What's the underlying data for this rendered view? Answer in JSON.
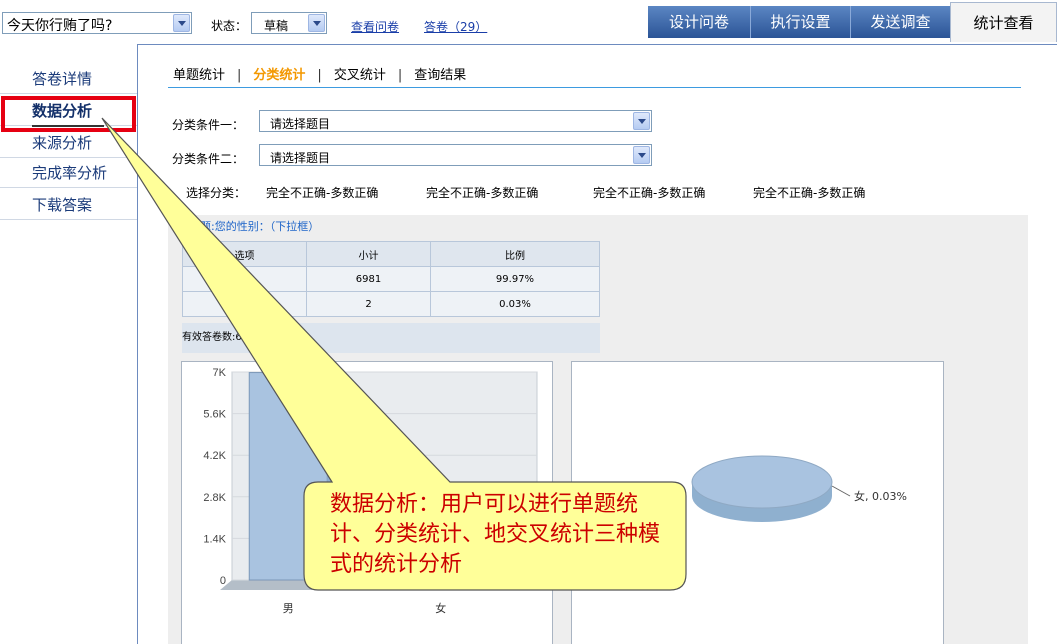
{
  "header": {
    "survey_select_value": "今天你行贿了吗?",
    "status_label": "状态：",
    "status_value": "草稿",
    "view_link": "查看问卷",
    "answers_link": "答卷（29）",
    "tabs": [
      {
        "label": "设计问卷",
        "active": false
      },
      {
        "label": "执行设置",
        "active": false
      },
      {
        "label": "发送调查",
        "active": false
      },
      {
        "label": "统计查看",
        "active": true
      }
    ]
  },
  "sidebar": {
    "items": [
      {
        "label": "答卷详情",
        "active": false
      },
      {
        "label": "数据分析",
        "active": true
      },
      {
        "label": "来源分析",
        "active": false
      },
      {
        "label": "完成率分析",
        "active": false
      },
      {
        "label": "下载答案",
        "active": false
      }
    ],
    "highlight_color": "#e60012"
  },
  "main": {
    "subtabs": [
      {
        "label": "单题统计",
        "active": false
      },
      {
        "label": "分类统计",
        "active": true
      },
      {
        "label": "交叉统计",
        "active": false
      },
      {
        "label": "查询结果",
        "active": false
      }
    ],
    "condition1_label": "分类条件一：",
    "condition1_value": "请选择题目",
    "condition2_label": "分类条件二：",
    "condition2_value": "请选择题目",
    "choose_label": "选择分类：",
    "choose_options": [
      "完全不正确-多数正确",
      "完全不正确-多数正确",
      "完全不正确-多数正确",
      "完全不正确-多数正确"
    ],
    "question_title": "题:您的性别：（下拉框）",
    "table": {
      "headers": [
        "选项",
        "小计",
        "比例"
      ],
      "rows": [
        [
          "",
          "6981",
          "99.97%"
        ],
        [
          "",
          "2",
          "0.03%"
        ]
      ]
    },
    "valid_label": "有效答卷数:698"
  },
  "chart_data": [
    {
      "type": "bar",
      "categories": [
        "男",
        "女"
      ],
      "values": [
        6981,
        2
      ],
      "ylim": [
        0,
        7000
      ],
      "yticks": [
        "0",
        "1.4K",
        "2.8K",
        "4.2K",
        "5.6K",
        "7K"
      ],
      "data_label": "6.",
      "bar_color": "#a9c3e0"
    },
    {
      "type": "pie",
      "slices": [
        {
          "label": "男",
          "value": 99.97
        },
        {
          "label": "女",
          "value": 0.03
        }
      ],
      "annotation": "女, 0.03%",
      "color": "#a9c3e0"
    }
  ],
  "callout": {
    "text": "数据分析：用户可以进行单题统计、分类统计、地交叉统计三种模式的统计分析",
    "fill": "#ffff99",
    "text_color": "#cc0000"
  }
}
